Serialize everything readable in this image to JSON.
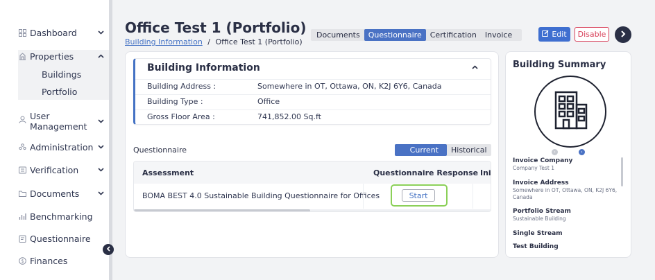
{
  "sidebar": {
    "items": [
      {
        "label": "Dashboard",
        "icon": "grid-icon",
        "chevron": "⌄"
      },
      {
        "label": "Properties",
        "icon": "building-icon",
        "chevron": "⌃"
      },
      {
        "label": "User Management",
        "icon": "user-icon",
        "chevron": "⌄"
      },
      {
        "label": "Administration",
        "icon": "users-icon",
        "chevron": "⌄"
      },
      {
        "label": "Verification",
        "icon": "checklist-icon",
        "chevron": "⌄"
      },
      {
        "label": "Documents",
        "icon": "folder-icon",
        "chevron": "⌄"
      },
      {
        "label": "Benchmarking",
        "icon": "bar-chart-icon"
      },
      {
        "label": "Questionnaire",
        "icon": "clipboard-icon"
      },
      {
        "label": "Finances",
        "icon": "dollar-icon"
      }
    ],
    "user_management_line1": "User",
    "user_management_line2": "Management",
    "sub_items": [
      "Buildings",
      "Portfolio"
    ]
  },
  "header": {
    "title": "Office Test 1 (Portfolio)",
    "breadcrumb_link": "Building Information",
    "breadcrumb_sep": "/",
    "breadcrumb_current": "Office Test 1 (Portfolio)",
    "tabs": [
      "Documents",
      "Questionnaire",
      "Certification",
      "Invoice"
    ],
    "active_tab": "Questionnaire",
    "edit_label": "Edit",
    "disable_label": "Disable"
  },
  "building_info": {
    "title": "Building Information",
    "rows": [
      {
        "label": "Building Address :",
        "value": "Somewhere in OT, Ottawa, ON, K2J 6Y6, Canada"
      },
      {
        "label": "Building Type :",
        "value": "Office"
      },
      {
        "label": "Gross Floor Area :",
        "value": "741,852.00 Sq.ft"
      }
    ]
  },
  "questionnaire": {
    "label": "Questionnaire",
    "toggle_current": "Current",
    "toggle_historical": "Historical",
    "columns": [
      "Assessment",
      "Questionnaire Response",
      "Init"
    ],
    "rows": [
      {
        "assessment": "BOMA BEST 4.0 Sustainable Building Questionnaire for Offices",
        "action": "Start"
      }
    ]
  },
  "summary": {
    "title": "Building Summary",
    "fields": [
      {
        "label": "Invoice Company",
        "value": "Company Test 1"
      },
      {
        "label": "Invoice Address",
        "value": "Somewhere in OT, Ottawa, ON, K2J 6Y6, Canada"
      },
      {
        "label": "Portfolio Stream",
        "value": "Sustainable Building"
      },
      {
        "label": "Single Stream",
        "value": ""
      },
      {
        "label": "Test Building",
        "value": ""
      }
    ]
  },
  "colors": {
    "accent": "#4a72c4",
    "danger": "#d8405a",
    "highlight": "#8bd058",
    "dark": "#2a2f45"
  }
}
